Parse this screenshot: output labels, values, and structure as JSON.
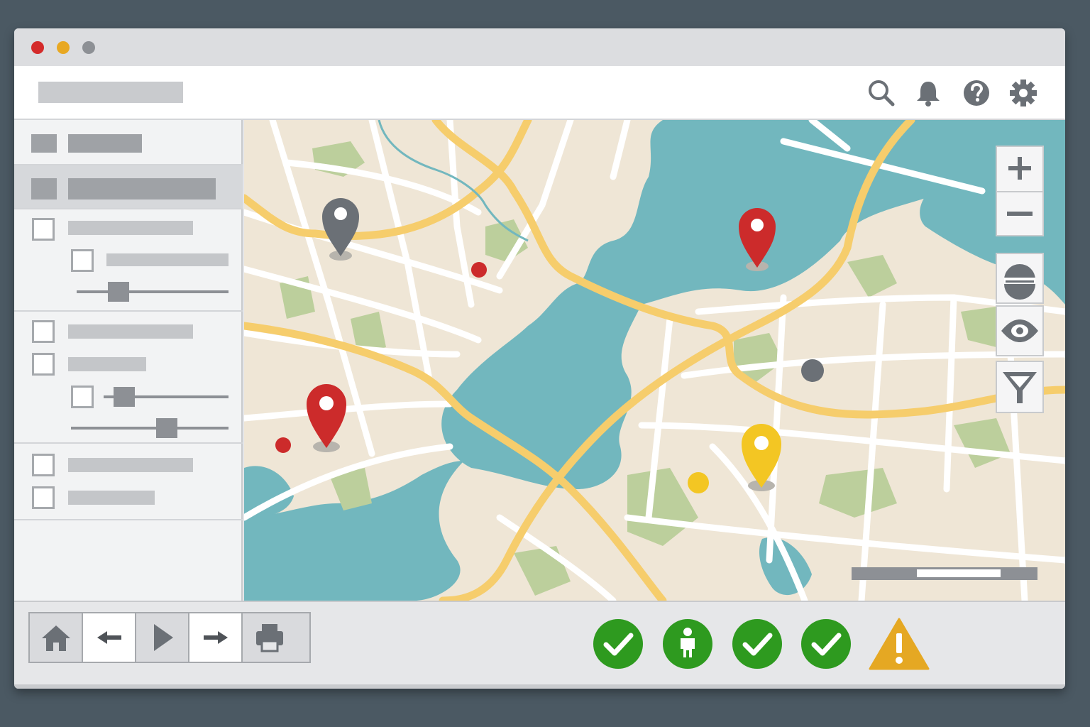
{
  "window": {
    "title": "",
    "traffic_lights": [
      "#d42b2b",
      "#e8a823",
      "#8d9095"
    ]
  },
  "toolbar": {
    "search_placeholder": "",
    "icons": [
      "search-icon",
      "bell-icon",
      "help-icon",
      "gear-icon"
    ]
  },
  "map": {
    "water_color": "#72b7be",
    "land_color": "#efe6d6",
    "park_color": "#bccf9c",
    "road_color": "#f6cd6c",
    "markers": [
      {
        "name": "gray-marker",
        "color": "#6b7076"
      },
      {
        "name": "red-marker",
        "color": "#cc2b2b"
      },
      {
        "name": "red-marker",
        "color": "#cc2b2b"
      },
      {
        "name": "yellow-marker",
        "color": "#f3c623"
      }
    ],
    "controls": [
      "zoom-in-icon",
      "zoom-out-icon",
      "layers-icon",
      "eye-icon",
      "filter-icon"
    ]
  },
  "bottombar": {
    "nav": [
      "home-icon",
      "back-arrow-icon",
      "play-icon",
      "forward-arrow-icon",
      "print-icon"
    ],
    "status": [
      {
        "name": "check-icon",
        "color": "#2e9a1f"
      },
      {
        "name": "person-icon",
        "color": "#2e9a1f"
      },
      {
        "name": "check-icon",
        "color": "#2e9a1f"
      },
      {
        "name": "check-icon",
        "color": "#2e9a1f"
      },
      {
        "name": "warning-icon",
        "color": "#e5a823"
      }
    ]
  }
}
